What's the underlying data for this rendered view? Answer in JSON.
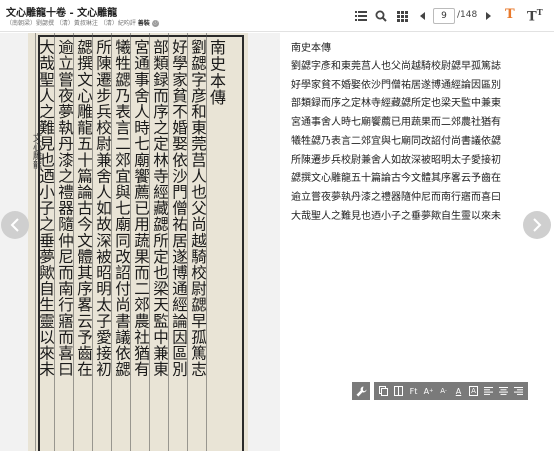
{
  "header": {
    "title": "文心雕龍十卷 - 文心雕龍",
    "meta": "（南朝梁）劉勰撰 （清）黃叔琳注 （清）紀昀評",
    "shelf_label": "善裝",
    "info_icon": "ⓘ"
  },
  "toolbar": {
    "current_page": "9",
    "total_pages": "/148",
    "mode_text_label": "T",
    "mode_trad_label": "T",
    "mode_trad_sub": "T",
    "accent_color": "#e8792b"
  },
  "scan": {
    "side_label": "文心雕龍",
    "columns": [
      "南史本傳",
      "劉勰字彦和東莞莒人也父尚越騎校尉勰早孤篤志",
      "好學家貧不婚娶依沙門僧祐居遂博通經論因區別",
      "部類録而序之定林寺經藏勰所定也梁天監中兼東",
      "宮通事舍人時七廟饗薦已用蔬果而二郊農社猶有",
      "犧牲勰乃表言二郊宜與七廟同改詔付尚書議依勰",
      "所陳遷步兵校尉兼舍人如故深被昭明太子愛接初",
      "勰撰文心雕龍五十篇論古今文體其序畧云予齒在",
      "逾立嘗夜夢執丹漆之禮器隨仲尼而南行寤而喜曰",
      "大哉聖人之難見也迺小子之垂夢歟自生靈以來未"
    ]
  },
  "text_panel": {
    "title": "南史本傳",
    "lines": [
      "劉勰字彥和東莞莒人也父尚越騎校尉勰早孤篤誌",
      "好學家貧不婚娶依沙門僧祐居遂博通經論因區別",
      "部類録而序之定林寺經藏勰所定也梁天監中兼東",
      "宮通事舍人時七廟饗薦已用蔬果而二郊農社猶有",
      "犧牲勰乃表言二郊宜與七廟同改詔付尚書議依勰",
      "所陳遷步兵校尉兼舍人如故深被昭明太子愛接初",
      "勰撰文心雕龍五十篇論古今文體其序畧云予齒在",
      "逾立嘗夜夢執丹漆之禮器隨仲尼而南行寤而喜曰",
      "大哉聖人之難見也迺小子之垂夢歟自生靈以來未"
    ]
  },
  "format_toolbar": {
    "font_label": "Ft",
    "size_up_label": "A",
    "size_down_label": "A",
    "color_label": "A",
    "bg_label": "A"
  }
}
